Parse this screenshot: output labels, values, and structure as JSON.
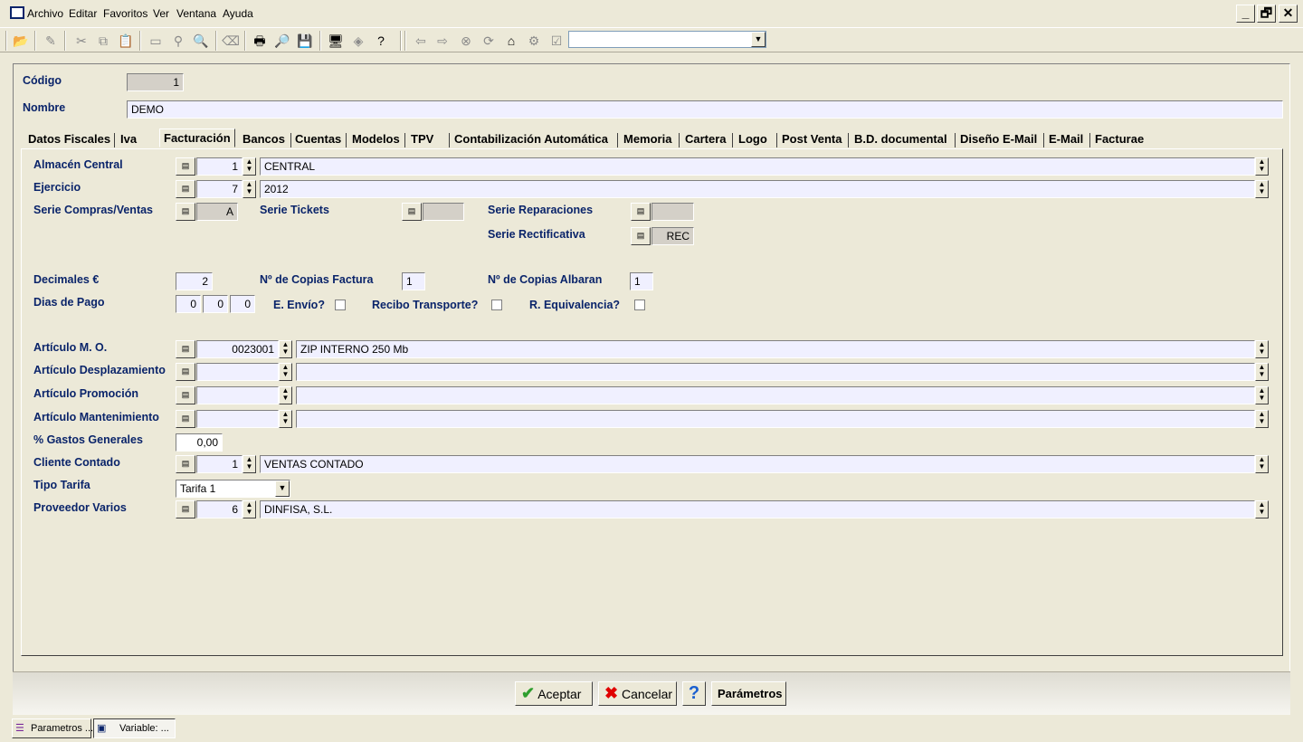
{
  "menubar": {
    "items": [
      "Archivo",
      "Editar",
      "Favoritos",
      "Ver",
      "Ventana",
      "Ayuda"
    ],
    "window_buttons": [
      "_",
      "🗗",
      "✕"
    ]
  },
  "toolbar": {
    "combo_value": ""
  },
  "header": {
    "codigo_label": "Código",
    "codigo_value": "1",
    "nombre_label": "Nombre",
    "nombre_value": "DEMO"
  },
  "tabs": [
    {
      "label": "Datos Fiscales"
    },
    {
      "label": "Iva"
    },
    {
      "label": "Facturación",
      "active": true
    },
    {
      "label": "Bancos"
    },
    {
      "label": "Cuentas"
    },
    {
      "label": "Modelos"
    },
    {
      "label": "TPV"
    },
    {
      "label": "Contabilización Automática"
    },
    {
      "label": "Memoria"
    },
    {
      "label": "Cartera"
    },
    {
      "label": "Logo"
    },
    {
      "label": "Post Venta"
    },
    {
      "label": "B.D. documental"
    },
    {
      "label": "Diseño E-Mail"
    },
    {
      "label": "E-Mail"
    },
    {
      "label": "Facturae"
    }
  ],
  "form": {
    "almacen": {
      "label": "Almacén Central",
      "code": "1",
      "desc": "CENTRAL"
    },
    "ejercicio": {
      "label": "Ejercicio",
      "code": "7",
      "desc": "2012"
    },
    "serie_cv": {
      "label": "Serie Compras/Ventas",
      "value": "A"
    },
    "serie_tickets": {
      "label": "Serie Tickets",
      "value": ""
    },
    "serie_reparaciones": {
      "label": "Serie Reparaciones",
      "value": ""
    },
    "serie_rectificativa": {
      "label": "Serie Rectificativa",
      "value": "REC"
    },
    "decimales": {
      "label": "Decimales €",
      "value": "2"
    },
    "copias_factura": {
      "label": "Nº de Copias Factura",
      "value": "1"
    },
    "copias_albaran": {
      "label": "Nº de Copias Albaran",
      "value": "1"
    },
    "dias_pago": {
      "label": "Dias de Pago",
      "values": [
        "0",
        "0",
        "0"
      ]
    },
    "e_envio": {
      "label": "E. Envío?",
      "checked": false
    },
    "recibo_transporte": {
      "label": "Recibo Transporte?",
      "checked": false
    },
    "r_equivalencia": {
      "label": "R. Equivalencia?",
      "checked": false
    },
    "articulo_mo": {
      "label": "Artículo M. O.",
      "code": "0023001",
      "desc": "ZIP INTERNO 250 Mb"
    },
    "articulo_desplazamiento": {
      "label": "Artículo Desplazamiento",
      "code": "",
      "desc": ""
    },
    "articulo_promocion": {
      "label": "Artículo Promoción",
      "code": "",
      "desc": ""
    },
    "articulo_mantenimiento": {
      "label": "Artículo Mantenimiento",
      "code": "",
      "desc": ""
    },
    "gastos_generales": {
      "label": "% Gastos Generales",
      "value": "0,00"
    },
    "cliente_contado": {
      "label": "Cliente Contado",
      "code": "1",
      "desc": "VENTAS CONTADO"
    },
    "tipo_tarifa": {
      "label": "Tipo Tarifa",
      "value": "Tarifa 1"
    },
    "proveedor_varios": {
      "label": "Proveedor Varios",
      "code": "6",
      "desc": "DINFISA, S.L."
    }
  },
  "footer": {
    "aceptar": "Aceptar",
    "cancelar": "Cancelar",
    "help": "?",
    "parametros": "Parámetros"
  },
  "taskbar": {
    "items": [
      "Parametros ...",
      "Variable: ..."
    ]
  },
  "colors": {
    "label_blue": "#0a246a",
    "field_bg": "#f0f0ff",
    "face": "#ece9d8"
  }
}
